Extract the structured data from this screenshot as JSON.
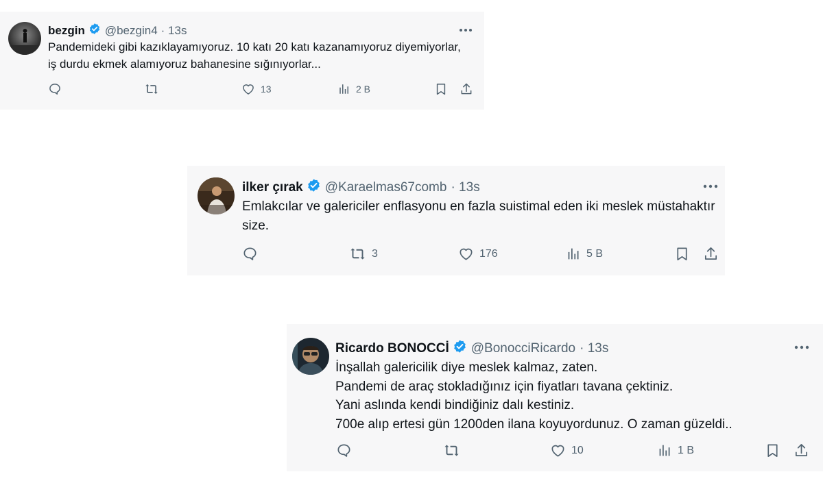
{
  "tweets": [
    {
      "name": "bezgin",
      "handle": "@bezgin4",
      "time": "· 13s",
      "text": "Pandemideki gibi kazıklayamıyoruz. 10 katı 20 katı kazanamıyoruz diyemiyorlar, iş durdu ekmek alamıyoruz bahanesine sığınıyorlar...",
      "reposts": "",
      "likes": "13",
      "views": "2 B"
    },
    {
      "name": "ilker çırak",
      "handle": "@Karaelmas67comb",
      "time": "· 13s",
      "text": "Emlakcılar ve galericiler enflasyonu en fazla suistimal eden iki meslek müstahaktır size.",
      "reposts": "3",
      "likes": "176",
      "views": "5 B"
    },
    {
      "name": "Ricardo BONOCCİ",
      "handle": "@BonocciRicardo",
      "time": "· 13s",
      "lines": [
        "İnşallah galericilik diye meslek kalmaz, zaten.",
        "Pandemi de araç stokladığınız için fiyatları tavana çektiniz.",
        "Yani aslında kendi bindiğiniz dalı kestiniz.",
        "700e alıp ertesi gün 1200den ilana koyuyordunuz. O zaman güzeldi.."
      ],
      "reposts": "",
      "likes": "10",
      "views": "1 B"
    }
  ],
  "colors": {
    "card_bg": "#f7f7f8",
    "verified": "#1d9bf0",
    "muted": "#536471",
    "text": "#0f1419"
  },
  "icons": [
    "reply-icon",
    "repost-icon",
    "like-icon",
    "views-icon",
    "bookmark-icon",
    "share-icon",
    "more-icon",
    "verified-badge-icon"
  ]
}
